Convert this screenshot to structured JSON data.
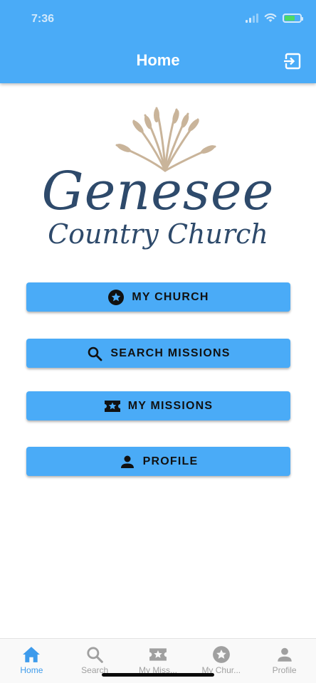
{
  "status_bar": {
    "time": "7:36"
  },
  "header": {
    "title": "Home"
  },
  "logo": {
    "line1": "Genesee",
    "line2": "Country Church"
  },
  "menu": [
    {
      "label": "MY CHURCH",
      "icon": "star-circle-icon"
    },
    {
      "label": "SEARCH MISSIONS",
      "icon": "search-icon"
    },
    {
      "label": "MY MISSIONS",
      "icon": "ticket-star-icon"
    },
    {
      "label": "PROFILE",
      "icon": "person-icon"
    }
  ],
  "tabs": [
    {
      "label": "Home",
      "icon": "home-icon",
      "active": true
    },
    {
      "label": "Search",
      "icon": "search-icon",
      "active": false
    },
    {
      "label": "My Miss...",
      "icon": "ticket-star-icon",
      "active": false
    },
    {
      "label": "My Chur...",
      "icon": "star-circle-icon",
      "active": false
    },
    {
      "label": "Profile",
      "icon": "person-icon",
      "active": false
    }
  ],
  "colors": {
    "primary": "#4aabf7",
    "logo_text": "#2e4a6b",
    "wheat": "#c9b49a",
    "tab_active": "#3d9bec",
    "tab_inactive": "#a0a0a0"
  }
}
